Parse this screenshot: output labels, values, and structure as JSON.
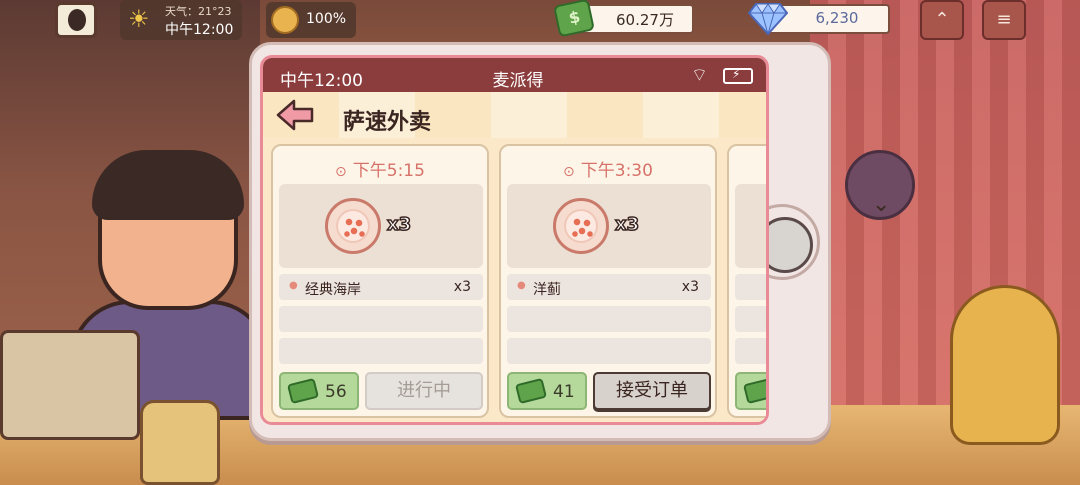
{
  "hud": {
    "clock": "中午12:00",
    "weather_text": "天气：21°23",
    "mood_value": "100%",
    "money": "60.27万",
    "gems": "6,230"
  },
  "phone": {
    "status_time": "中午12:00",
    "status_brand": "麦派得",
    "title": "萨速外卖",
    "orders": [
      {
        "deadline": "下午5:15",
        "image_qty": "x3",
        "items": [
          {
            "name": "经典海岸",
            "qty": "x3"
          }
        ],
        "reward": "56",
        "action": "进行中",
        "action_state": "in-progress"
      },
      {
        "deadline": "下午3:30",
        "image_qty": "x3",
        "items": [
          {
            "name": "洋蓟",
            "qty": "x3"
          }
        ],
        "reward": "41",
        "action": "接受订单",
        "action_state": "available"
      }
    ]
  },
  "colors": {
    "status_bar": "#8b3c3c",
    "screen_border": "#e98b96",
    "deadline_text": "#d7726a",
    "reward_bg": "#b4d99a"
  }
}
